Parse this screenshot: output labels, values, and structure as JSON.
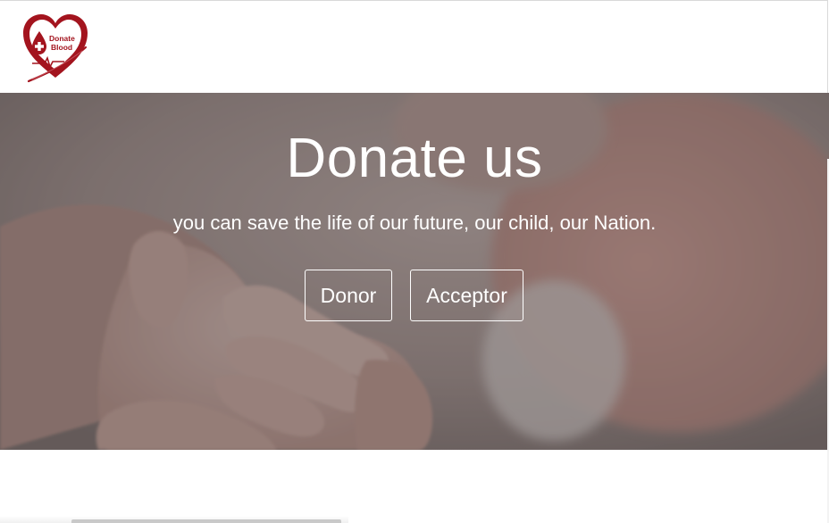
{
  "header": {
    "logo": {
      "icon": "heart-blood-drop-logo",
      "line1": "Donate",
      "line2": "Blood",
      "color": "#a3141e"
    }
  },
  "hero": {
    "title": "Donate us",
    "subtitle": "you can save the life of our future, our child, our Nation.",
    "buttons": {
      "donor": "Donor",
      "acceptor": "Acceptor"
    },
    "image": "baby-hand-holding-adult-hand-photo"
  },
  "colors": {
    "brand": "#a3141e",
    "hero_text": "#ffffff"
  }
}
